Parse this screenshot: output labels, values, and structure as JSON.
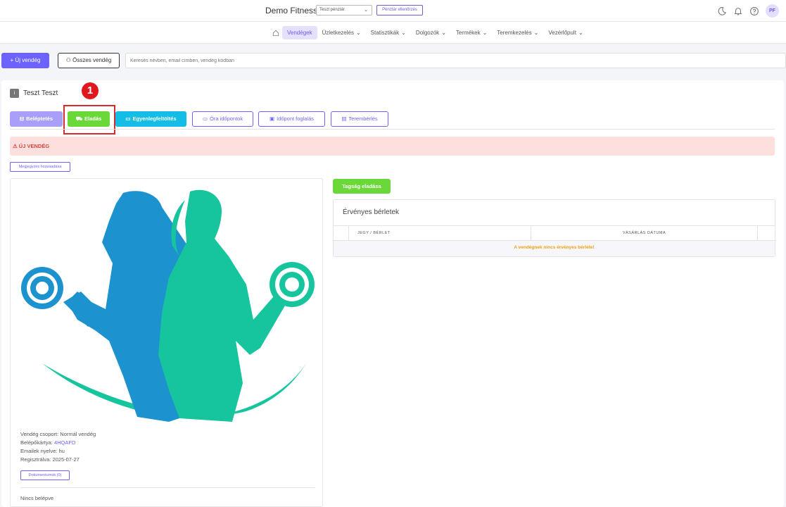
{
  "header": {
    "brand": "Demo Fitness",
    "cash_register": "Teszt pénztár",
    "cash_check": "Pénztár ellenőrzés",
    "avatar_initials": "PF"
  },
  "nav": {
    "items": [
      {
        "label": "Vendégek"
      },
      {
        "label": "Üzletkezelés"
      },
      {
        "label": "Statisztikák"
      },
      {
        "label": "Dolgozók"
      },
      {
        "label": "Termékek"
      },
      {
        "label": "Teremkezelés"
      },
      {
        "label": "Vezérlőpult"
      }
    ]
  },
  "toolbar": {
    "new_guest": "+ Új vendég",
    "all_guests": "Összes vendég",
    "search_placeholder": "Keresés névben, email címben, vendég kódban"
  },
  "guest": {
    "icon_text": "i",
    "name": "Teszt Teszt",
    "alert": "⚠ ÚJ VENDÉG",
    "note_button": "Megjegyzés hozzáadása"
  },
  "actions": {
    "entry": "Beléptetés",
    "sale": "Eladás",
    "topup": "Egyenlegfeltöltés",
    "class_times": "Óra időpontok",
    "booking": "Időpont foglalás",
    "room_rent": "Terembérlés"
  },
  "annotation": {
    "marker": "1"
  },
  "profile": {
    "group_label": "Vendég csoport: ",
    "group_value": "Normál vendég",
    "card_label": "Belépőkártya: ",
    "card_value": "4HQAFD",
    "lang_label": "Emailek nyelve: ",
    "lang_value": "hu",
    "reg_label": "Regisztrálva: ",
    "reg_value": "2025-07-27",
    "documents_button": "Dokumentumok (0)",
    "no_entry": "Nincs belépve"
  },
  "memberships": {
    "sell_button": "Tagság eladása",
    "title": "Érvényes bérletek",
    "col_ticket": "JEGY / BÉRLET",
    "col_date": "VÁSÁRLÁS DÁTUMA",
    "empty_message": "A vendégnek nincs érvényes bérlete!"
  },
  "colors": {
    "accent": "#6c63ff",
    "success": "#6ad839",
    "info": "#13bde5",
    "danger": "#e0191f",
    "logo_blue": "#1c92cf",
    "logo_teal": "#16c49d"
  }
}
